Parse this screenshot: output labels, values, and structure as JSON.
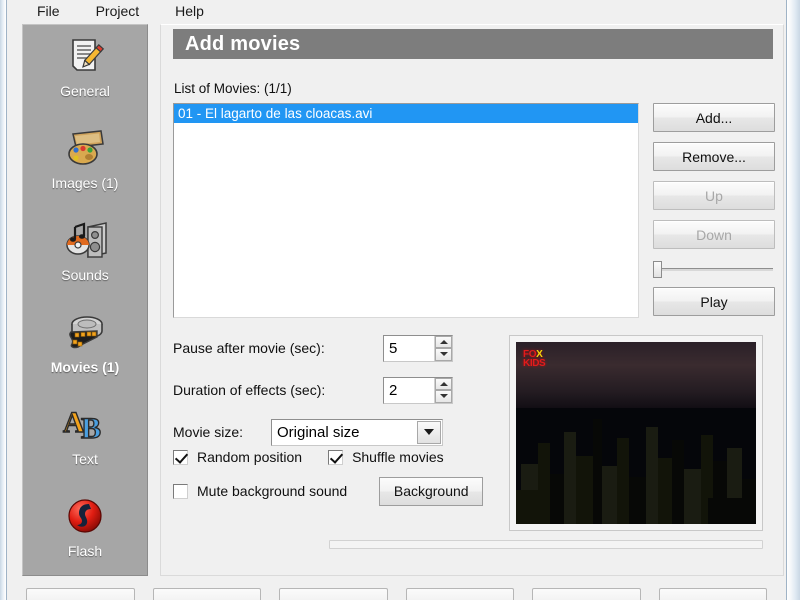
{
  "window": {
    "menu": [
      {
        "label": "File",
        "name": "menu-file"
      },
      {
        "label": "Project",
        "name": "menu-project"
      },
      {
        "label": "Help",
        "name": "menu-help"
      }
    ]
  },
  "sidebar": {
    "items": [
      {
        "label": "General",
        "icon": "document-pencil-icon",
        "active": false
      },
      {
        "label": "Images (1)",
        "icon": "palette-icon",
        "active": false
      },
      {
        "label": "Sounds",
        "icon": "speaker-note-icon",
        "active": false
      },
      {
        "label": "Movies (1)",
        "icon": "film-reel-icon",
        "active": true
      },
      {
        "label": "Text",
        "icon": "ab-letters-icon",
        "active": false
      },
      {
        "label": "Flash",
        "icon": "flash-icon",
        "active": false
      }
    ]
  },
  "main": {
    "title": "Add movies",
    "list_caption": "List of Movies:  (1/1)",
    "movies": [
      {
        "label": "01 - El lagarto de las cloacas.avi",
        "selected": true
      }
    ],
    "buttons": [
      {
        "label": "Add...",
        "name": "add-button",
        "disabled": false
      },
      {
        "label": "Remove...",
        "name": "remove-button",
        "disabled": false
      },
      {
        "label": "Up",
        "name": "up-button",
        "disabled": true
      },
      {
        "label": "Down",
        "name": "down-button",
        "disabled": true
      }
    ],
    "play_button": "Play",
    "slider": {
      "value": 0,
      "min": 0,
      "max": 100
    },
    "fields": {
      "pause_label": "Pause after movie (sec):",
      "pause_value": "5",
      "duration_label": "Duration of effects (sec):",
      "duration_value": "2",
      "size_label": "Movie size:",
      "size_value": "Original size",
      "size_options": [
        "Original size"
      ]
    },
    "checkboxes": [
      {
        "label": "Random position",
        "checked": true,
        "name": "random-position-checkbox"
      },
      {
        "label": "Shuffle movies",
        "checked": true,
        "name": "shuffle-movies-checkbox"
      },
      {
        "label": "Mute background sound",
        "checked": false,
        "name": "mute-background-sound-checkbox"
      }
    ],
    "background_button": "Background",
    "preview": {
      "watermark_fo": "FO",
      "watermark_x": "X",
      "watermark_kids": "KIDS"
    }
  },
  "colors": {
    "selection_blue": "#2196f3",
    "title_bar_gray": "#7d7d7d",
    "sidebar_gray": "#a6a6a6",
    "window_bg": "#f0f0f0"
  }
}
